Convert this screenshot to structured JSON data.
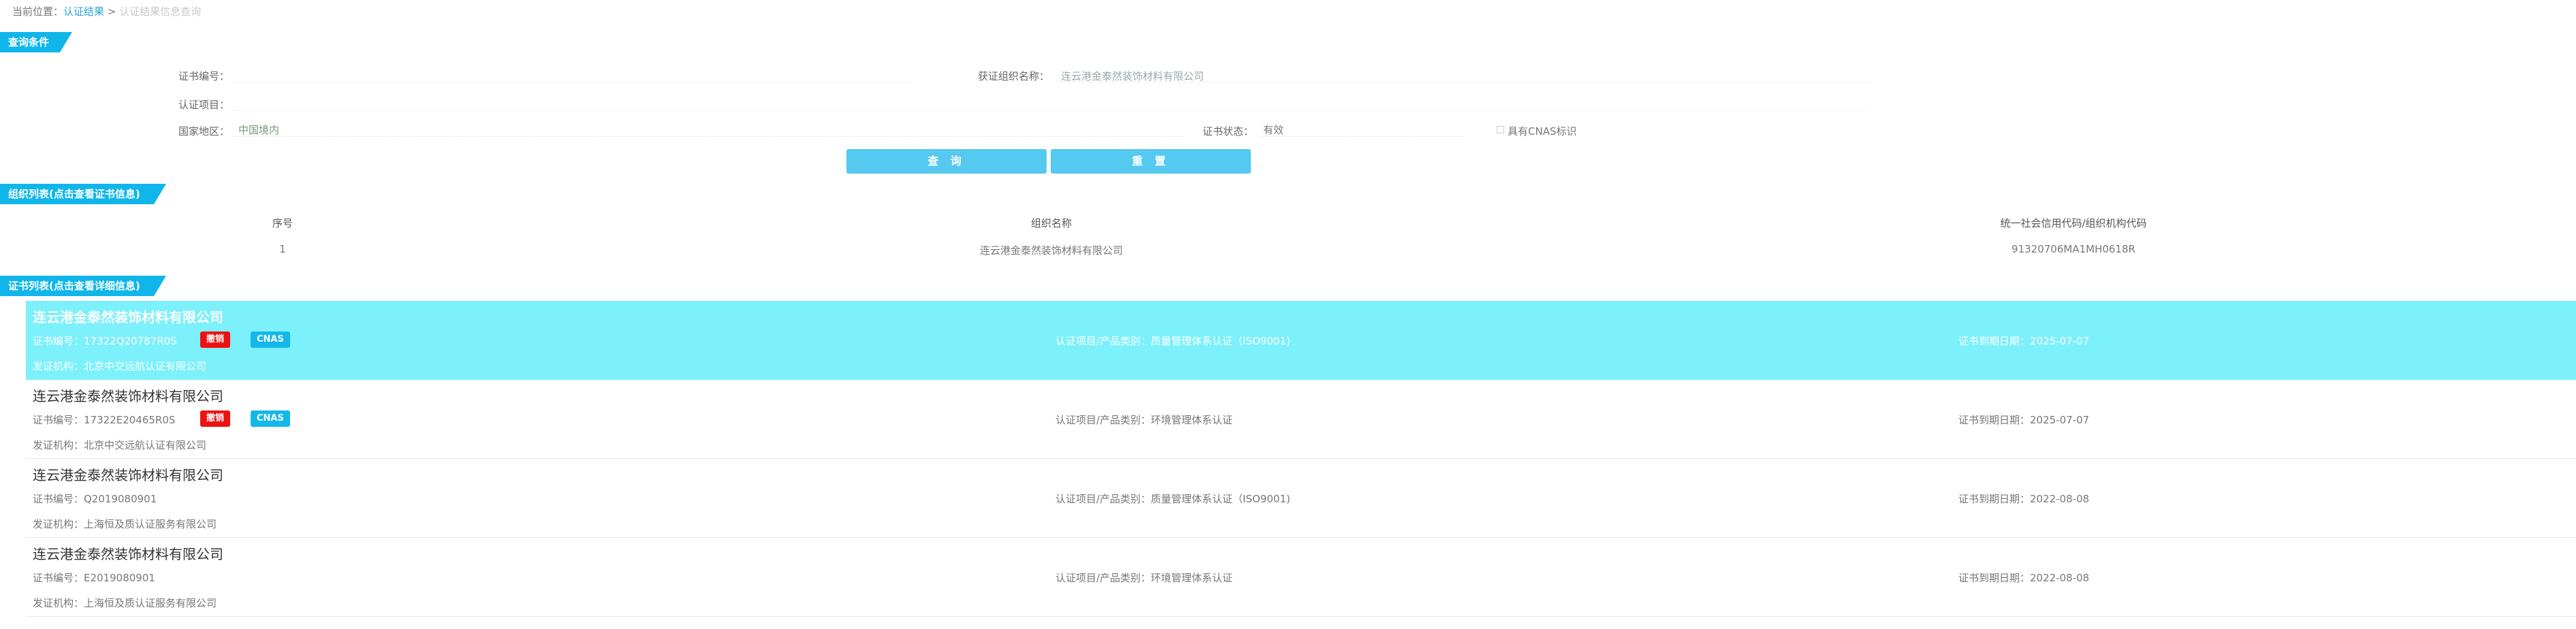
{
  "breadcrumb": {
    "prefix": "当前位置：",
    "link": "认证结果",
    "separator": " > ",
    "current": "认证结果信息查询"
  },
  "query": {
    "section_title": "查询条件",
    "cert_no_label": "证书编号：",
    "cert_no_value": "",
    "org_label": "获证组织名称：",
    "org_value": "连云港金泰然装饰材料有限公司",
    "item_label": "认证项目：",
    "item_value": "",
    "region_label": "国家地区：",
    "region_value": "中国境内",
    "status_label": "证书状态：",
    "status_value": "有效",
    "cnas_checkbox_label": "具有CNAS标识",
    "search_button": "查 询",
    "reset_button": "重 置"
  },
  "org_list": {
    "section_title": "组织列表(点击查看证书信息)",
    "columns": [
      "序号",
      "组织名称",
      "统一社会信用代码/组织机构代码"
    ],
    "rows": [
      [
        "1",
        "连云港金泰然装饰材料有限公司",
        "91320706MA1MH0618R"
      ]
    ]
  },
  "cert_list": {
    "section_title": "证书列表(点击查看详细信息)",
    "items": [
      {
        "name": "连云港金泰然装饰材料有限公司",
        "cert_no": "证书编号：17322Q20787R0S",
        "item": "认证项目/产品类别：质量管理体系认证（ISO9001)",
        "expiry": "证书到期日期：2025-07-07",
        "issuer": "发证机构：北京中交远航认证有限公司",
        "badge_revoked": "撤销",
        "badge_cnas": "CNAS"
      },
      {
        "name": "连云港金泰然装饰材料有限公司",
        "cert_no": "证书编号：17322E20465R0S",
        "item": "认证项目/产品类别：环境管理体系认证",
        "expiry": "证书到期日期：2025-07-07",
        "issuer": "发证机构：北京中交远航认证有限公司",
        "badge_revoked": "撤销",
        "badge_cnas": "CNAS"
      },
      {
        "name": "连云港金泰然装饰材料有限公司",
        "cert_no": "证书编号：Q2019080901",
        "item": "认证项目/产品类别：质量管理体系认证（ISO9001)",
        "expiry": "证书到期日期：2022-08-08",
        "issuer": "发证机构：上海恒及质认证服务有限公司"
      },
      {
        "name": "连云港金泰然装饰材料有限公司",
        "cert_no": "证书编号：E2019080901",
        "item": "认证项目/产品类别：环境管理体系认证",
        "expiry": "证书到期日期：2022-08-08",
        "issuer": "发证机构：上海恒及质认证服务有限公司"
      }
    ]
  },
  "colors": {
    "accent": "#10b6ea",
    "button": "#55c9f0",
    "active_row": "#7cf0fb",
    "badge_red": "#ee1111"
  }
}
